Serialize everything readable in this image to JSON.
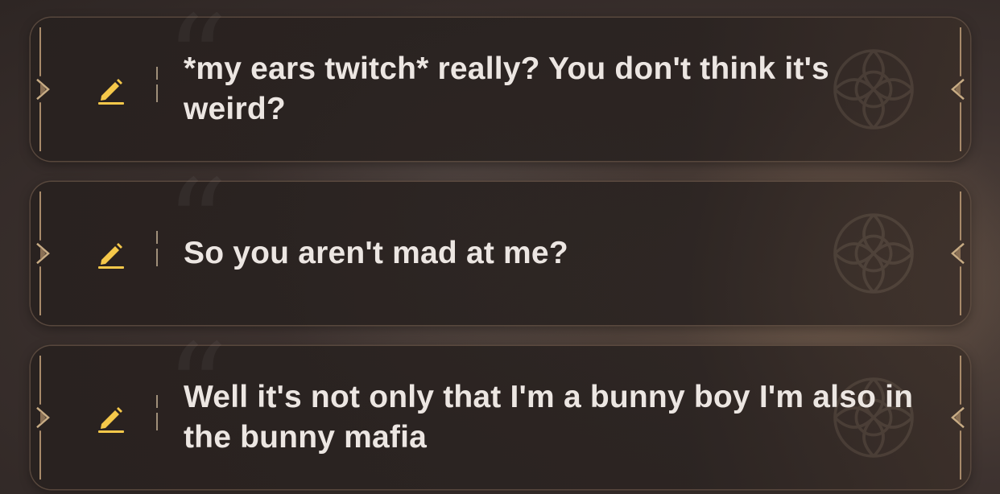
{
  "accent_color": "#f5c84a",
  "frame_color": "#a88a6a",
  "options": [
    {
      "icon": "pencil-icon",
      "text": "*my ears twitch* really? You don't think it's weird?"
    },
    {
      "icon": "pencil-icon",
      "text": "So you aren't mad at me?"
    },
    {
      "icon": "pencil-icon",
      "text": "Well it's not only that I'm a bunny boy I'm also in the bunny mafia"
    }
  ]
}
